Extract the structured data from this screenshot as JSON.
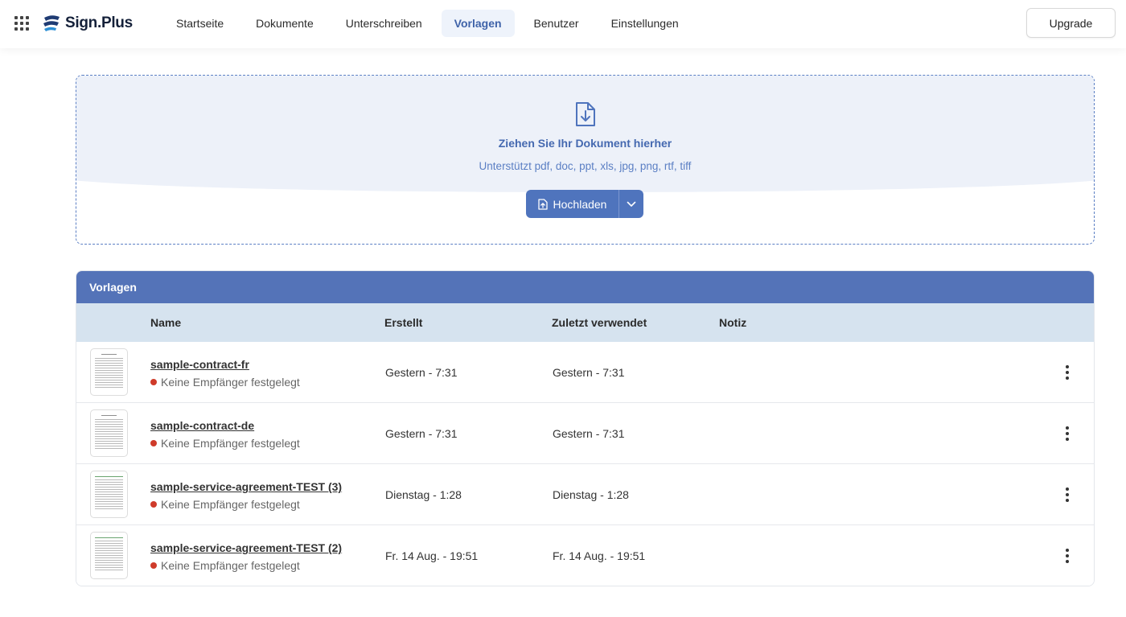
{
  "app": {
    "logo_text": "Sign.Plus",
    "apps_icon": "grid-icon",
    "brand_color": "#1f3b73"
  },
  "nav": {
    "items": [
      {
        "label": "Startseite",
        "active": false
      },
      {
        "label": "Dokumente",
        "active": false
      },
      {
        "label": "Unterschreiben",
        "active": false
      },
      {
        "label": "Vorlagen",
        "active": true
      },
      {
        "label": "Benutzer",
        "active": false
      },
      {
        "label": "Einstellungen",
        "active": false
      }
    ],
    "upgrade_label": "Upgrade"
  },
  "dropzone": {
    "icon": "file-download-icon",
    "title": "Ziehen Sie Ihr Dokument hierher",
    "subtitle": "Unterstützt pdf, doc, ppt, xls, jpg, png, rtf, tiff",
    "upload_label": "Hochladen",
    "upload_icon": "file-upload-icon",
    "dropdown_icon": "chevron-down-icon"
  },
  "templates": {
    "title": "Vorlagen",
    "columns": {
      "name": "Name",
      "created": "Erstellt",
      "last_used": "Zuletzt verwendet",
      "note": "Notiz"
    },
    "rows": [
      {
        "name": "sample-contract-fr",
        "status": "Keine Empfänger festgelegt",
        "created": "Gestern - 7:31",
        "last_used": "Gestern - 7:31",
        "note": "",
        "thumb_style": "contract"
      },
      {
        "name": "sample-contract-de",
        "status": "Keine Empfänger festgelegt",
        "created": "Gestern - 7:31",
        "last_used": "Gestern - 7:31",
        "note": "",
        "thumb_style": "contract"
      },
      {
        "name": "sample-service-agreement-TEST (3)",
        "status": "Keine Empfänger festgelegt",
        "created": "Dienstag - 1:28",
        "last_used": "Dienstag - 1:28",
        "note": "",
        "thumb_style": "agreement"
      },
      {
        "name": "sample-service-agreement-TEST (2)",
        "status": "Keine Empfänger festgelegt",
        "created": "Fr. 14 Aug. - 19:51",
        "last_used": "Fr. 14 Aug. - 19:51",
        "note": "",
        "thumb_style": "agreement"
      }
    ],
    "status_color": "#cf3b2a",
    "header_color": "#5473b8",
    "column_header_color": "#d6e3ef"
  }
}
